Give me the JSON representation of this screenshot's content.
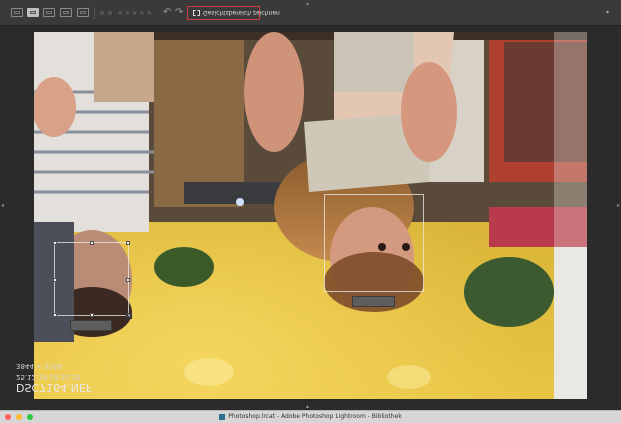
{
  "window": {
    "title": "Photoshop.lrcat - Adobe Photoshop Lightroom - Bibliothek"
  },
  "toolbar": {
    "view_buttons": [
      "grid-view",
      "loupe-view",
      "compare-view",
      "survey-view",
      "people-view"
    ],
    "rating_stars": "★★★★★",
    "face_region_label": "Gesichtsbereich zeichnen"
  },
  "photo": {
    "filename": "DSC7164.NEF",
    "datetime": "25.12.16 18:32:28",
    "dimensions": "3844 × 5568"
  },
  "colors": {
    "toolbar_bg": "#3a3a3a",
    "highlight_border": "#d23b3b",
    "wall_yellow": "#d8b233"
  }
}
